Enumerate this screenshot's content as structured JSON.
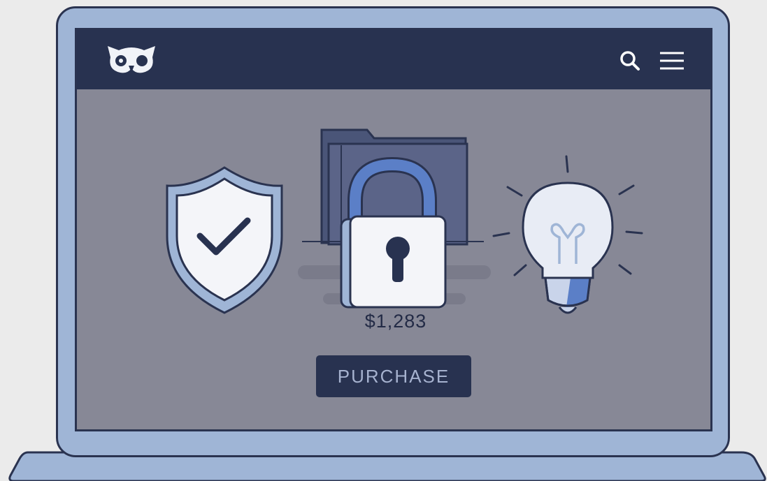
{
  "header": {
    "logo_icon": "owl-logo-icon",
    "search_icon": "search-icon",
    "menu_icon": "hamburger-menu-icon"
  },
  "illustration": {
    "shield_icon": "shield-check-icon",
    "lock_icon": "padlock-icon",
    "folder_icon": "folder-icon",
    "bulb_icon": "lightbulb-icon"
  },
  "product": {
    "price": "$1,283",
    "purchase_label": "PURCHASE"
  },
  "colors": {
    "header_bg": "#283250",
    "screen_bg": "#878896",
    "laptop_frame": "#9fb5d6",
    "outline": "#2a3350",
    "button_text": "#a6b2cf",
    "accent_blue": "#5b7fc7"
  }
}
